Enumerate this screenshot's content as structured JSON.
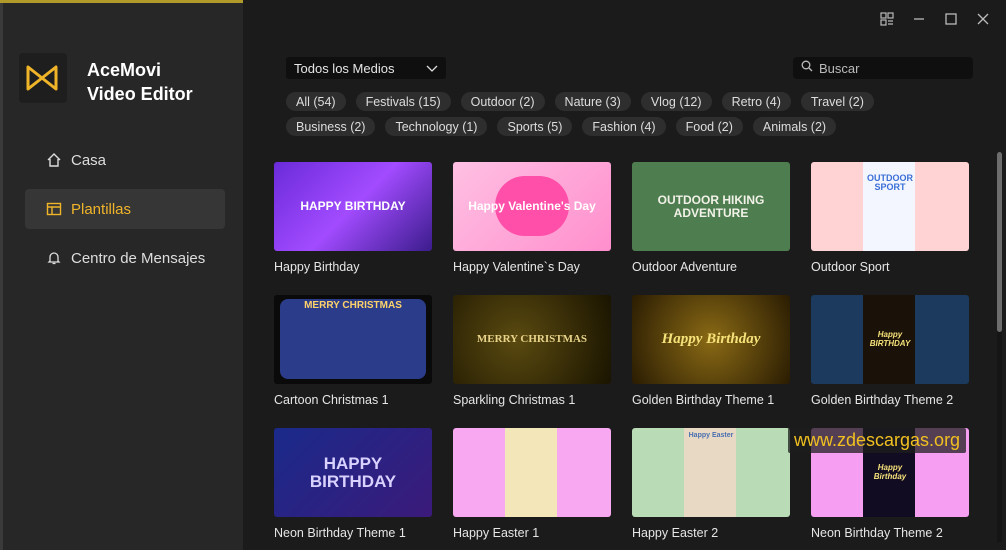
{
  "app": {
    "name_line1": "AceMovi",
    "name_line2": "Video Editor",
    "accent": "#f0b429"
  },
  "window_controls": [
    "grid-icon",
    "minimize-icon",
    "maximize-icon",
    "close-icon"
  ],
  "sidebar": {
    "items": [
      {
        "label": "Casa",
        "icon": "home-icon",
        "active": false
      },
      {
        "label": "Plantillas",
        "icon": "templates-icon",
        "active": true
      },
      {
        "label": "Centro de Mensajes",
        "icon": "bell-icon",
        "active": false
      }
    ]
  },
  "filter": {
    "selected": "Todos los Medios"
  },
  "search": {
    "placeholder": "Buscar"
  },
  "categories_row1": [
    "All (54)",
    "Festivals (15)",
    "Outdoor (2)",
    "Nature (3)",
    "Vlog (12)",
    "Retro (4)",
    "Travel (2)"
  ],
  "categories_row2": [
    "Business (2)",
    "Technology (1)",
    "Sports (5)",
    "Fashion (4)",
    "Food (2)",
    "Animals (2)"
  ],
  "templates": [
    {
      "title": "Happy Birthday",
      "thumb_text": "HAPPY BIRTHDAY"
    },
    {
      "title": "Happy Valentine`s Day",
      "thumb_text": "Happy Valentine's Day"
    },
    {
      "title": "Outdoor Adventure",
      "thumb_text": "OUTDOOR HIKING ADVENTURE"
    },
    {
      "title": "Outdoor Sport",
      "thumb_text": "OUTDOOR SPORT"
    },
    {
      "title": "Cartoon Christmas 1",
      "thumb_text": "MERRY CHRISTMAS"
    },
    {
      "title": "Sparkling Christmas 1",
      "thumb_text": "MERRY CHRISTMAS"
    },
    {
      "title": "Golden Birthday Theme 1",
      "thumb_text": "Happy Birthday"
    },
    {
      "title": "Golden Birthday Theme 2",
      "thumb_text": "Happy BIRTHDAY"
    },
    {
      "title": "Neon Birthday Theme 1",
      "thumb_text": "HAPPY BIRTHDAY"
    },
    {
      "title": "Happy Easter 1",
      "thumb_text": ""
    },
    {
      "title": "Happy Easter 2",
      "thumb_text": "Happy Easter"
    },
    {
      "title": "Neon Birthday Theme 2",
      "thumb_text": "Happy Birthday"
    }
  ],
  "watermark": "www.zdescargas.org"
}
